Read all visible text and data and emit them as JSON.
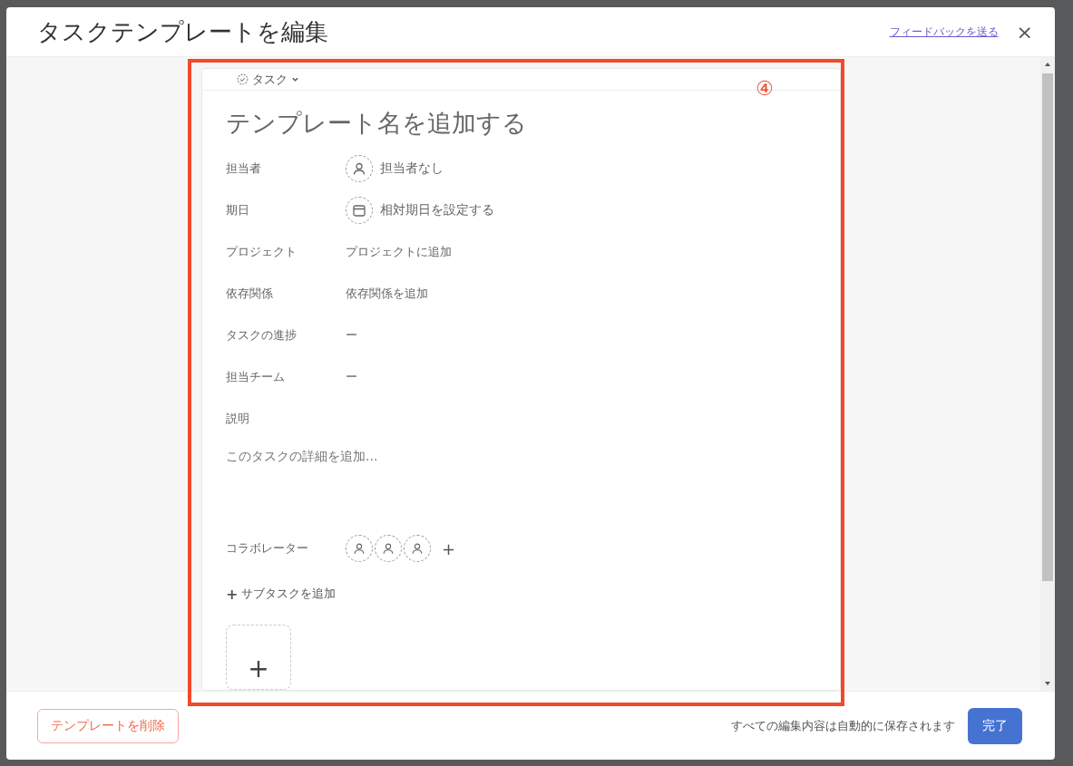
{
  "dialog": {
    "title": "タスクテンプレートを編集",
    "feedback_link": "フィードバックを送る",
    "close": "×"
  },
  "task_type": {
    "label": "タスク"
  },
  "template_name": {
    "placeholder": "テンプレート名を追加する"
  },
  "fields": [
    {
      "label": "担当者",
      "kind": "avatar",
      "value": "担当者なし"
    },
    {
      "label": "期日",
      "kind": "calendar",
      "value": "相対期日を設定する"
    },
    {
      "label": "プロジェクト",
      "kind": "text",
      "value": "プロジェクトに追加"
    },
    {
      "label": "依存関係",
      "kind": "text",
      "value": "依存関係を追加"
    },
    {
      "label": "タスクの進捗",
      "kind": "text",
      "value": "ー"
    },
    {
      "label": "担当チーム",
      "kind": "text",
      "value": "ー"
    }
  ],
  "description": {
    "label": "説明",
    "placeholder": "このタスクの詳細を追加..."
  },
  "collaborators": {
    "label": "コラボレーター",
    "avatars": [
      {
        "kind": "empty"
      },
      {
        "kind": "empty"
      },
      {
        "kind": "empty"
      }
    ],
    "add": "+"
  },
  "add_subtask": {
    "icon": "+",
    "label": "サブタスクを追加"
  },
  "attachment": {
    "add": "+"
  },
  "annotation": {
    "label": "④"
  },
  "footer": {
    "delete_button": "テンプレートを削除",
    "autosave_note": "すべての編集内容は自動的に保存されます",
    "done_button": "完了"
  }
}
